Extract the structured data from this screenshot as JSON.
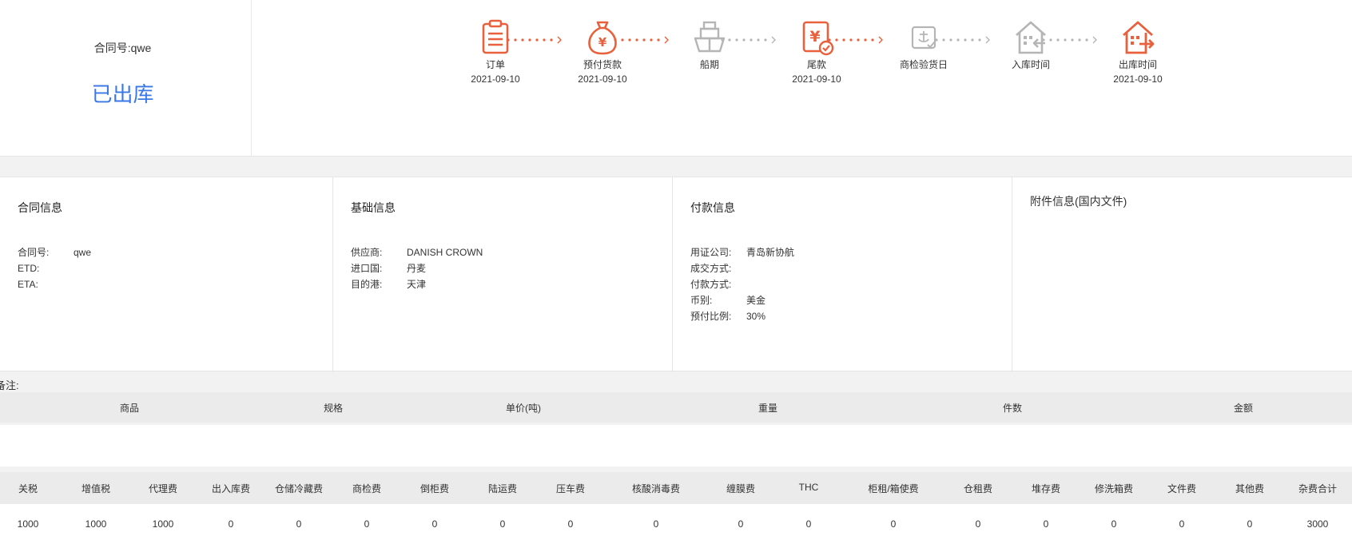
{
  "header": {
    "contract_label": "合同号:",
    "contract_no": "qwe",
    "status": "已出库"
  },
  "steps": [
    {
      "label": "订单",
      "date": "2021-09-10",
      "icon": "clipboard-icon",
      "active": true
    },
    {
      "label": "预付货款",
      "date": "2021-09-10",
      "icon": "money-bag-icon",
      "active": true
    },
    {
      "label": "船期",
      "date": "",
      "icon": "ship-icon",
      "active": false
    },
    {
      "label": "尾款",
      "date": "2021-09-10",
      "icon": "final-payment-icon",
      "active": true
    },
    {
      "label": "商检验货日",
      "date": "",
      "icon": "inspection-icon",
      "active": false
    },
    {
      "label": "入库时间",
      "date": "",
      "icon": "warehouse-in-icon",
      "active": false
    },
    {
      "label": "出库时间",
      "date": "2021-09-10",
      "icon": "warehouse-out-icon",
      "active": true
    }
  ],
  "colors": {
    "active": "#e8603c",
    "inactive": "#b5b5b5",
    "status": "#3b78e7"
  },
  "contract_info": {
    "title": "合同信息",
    "rows": [
      {
        "k": "合同号:",
        "v": "qwe"
      },
      {
        "k": "ETD:",
        "v": ""
      },
      {
        "k": "ETA:",
        "v": ""
      }
    ]
  },
  "basic_info": {
    "title": "基础信息",
    "rows": [
      {
        "k": "供应商:",
        "v": "DANISH CROWN"
      },
      {
        "k": "进口国:",
        "v": "丹麦"
      },
      {
        "k": "目的港:",
        "v": "天津"
      }
    ]
  },
  "payment_info": {
    "title": "付款信息",
    "rows": [
      {
        "k": "用证公司:",
        "v": "青岛新协航"
      },
      {
        "k": "成交方式:",
        "v": ""
      },
      {
        "k": "付款方式:",
        "v": ""
      },
      {
        "k": "币别:",
        "v": "美金"
      },
      {
        "k": "预付比例:",
        "v": "30%"
      }
    ]
  },
  "attachment_info": {
    "title": "附件信息(国内文件)"
  },
  "remark_label": "备注:",
  "goods_columns": [
    "商品",
    "规格",
    "单价(吨)",
    "重量",
    "件数",
    "金额"
  ],
  "fee_columns": [
    "关税",
    "增值税",
    "代理费",
    "出入库费",
    "仓储冷藏费",
    "商检费",
    "倒柜费",
    "陆运费",
    "压车费",
    "核酸消毒费",
    "缠膜费",
    "THC",
    "柜租/箱使费",
    "仓租费",
    "堆存费",
    "修洗箱费",
    "文件费",
    "其他费",
    "杂费合计"
  ],
  "fee_values": [
    "1000",
    "1000",
    "1000",
    "0",
    "0",
    "0",
    "0",
    "0",
    "0",
    "0",
    "0",
    "0",
    "0",
    "0",
    "0",
    "0",
    "0",
    "0",
    "3000"
  ]
}
